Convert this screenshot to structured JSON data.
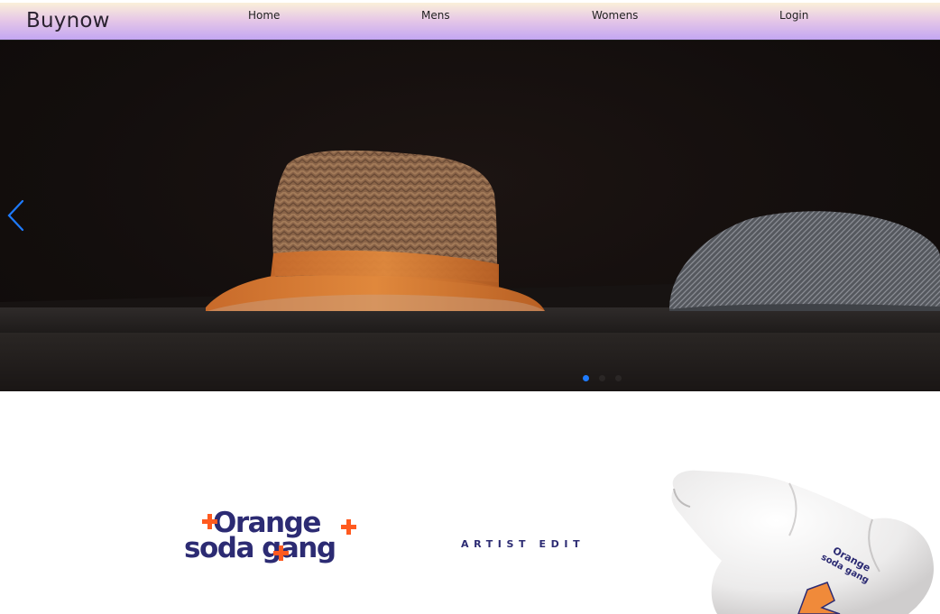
{
  "navbar": {
    "brand": "Buynow",
    "links": [
      "Home",
      "Mens",
      "Womens",
      "Login"
    ]
  },
  "hero": {
    "slide_count": 3,
    "active_slide": 1,
    "prev_icon": "chevron-left-icon",
    "accent_color": "#1e7bff"
  },
  "collab": {
    "logo_line1": "Orange",
    "logo_line2": "soda gang",
    "tagline": "ARTIST EDIT",
    "logo_color": "#2c2b73",
    "plus_color": "#ff5a1f",
    "product_print_line1": "Orange",
    "product_print_line2": "soda gang"
  }
}
